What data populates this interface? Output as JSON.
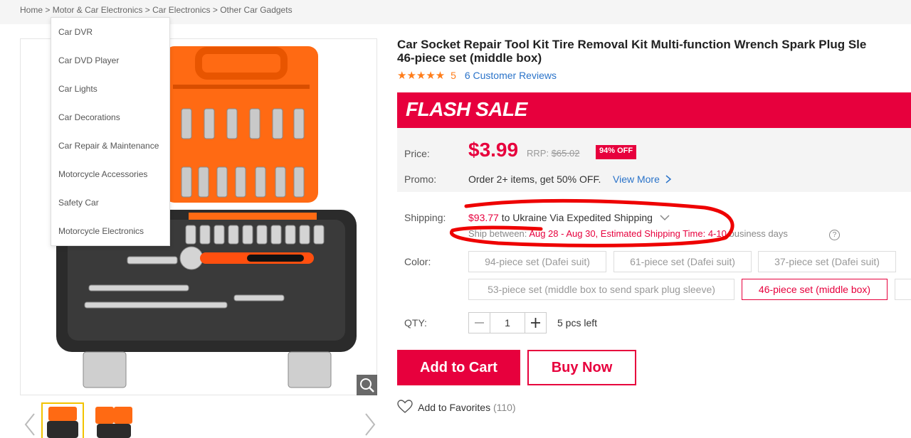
{
  "breadcrumb": {
    "items": [
      "Home",
      "Motor & Car Electronics",
      "Car Electronics",
      "Other Car Gadgets"
    ],
    "separator": ">"
  },
  "category_menu": {
    "items": [
      "Car DVR",
      "Car DVD Player",
      "Car Lights",
      "Car Decorations",
      "Car Repair & Maintenance",
      "Motorcycle Accessories",
      "Safety Car",
      "Motorcycle Electronics"
    ]
  },
  "product": {
    "title_line1": "Car Socket Repair Tool Kit Tire Removal Kit Multi-function Wrench Spark Plug Sle",
    "title_line2": "46-piece set (middle box)",
    "stars": "★★★★★",
    "rating": "5",
    "reviews": "6 Customer Reviews",
    "image_hint": "orange-black-socket-tool-case"
  },
  "flash_sale": {
    "label": "FLASH SALE"
  },
  "pricing": {
    "price_label": "Price:",
    "price": "$3.99",
    "rrp_label": "RRP:",
    "rrp_value": "$65.02",
    "discount": "94% OFF",
    "promo_label": "Promo:",
    "promo_text": "Order 2+ items, get 50% OFF.",
    "view_more": "View More"
  },
  "shipping": {
    "label": "Shipping:",
    "cost": "$93.77",
    "destination": "to Ukraine Via Expedited Shipping",
    "ship_between_label": "Ship between:",
    "ship_dates": "Aug 28 - Aug 30,",
    "estimated_label": "Estimated Shipping Time:",
    "estimated_days": "4-10",
    "business_days": "business days",
    "help": "?"
  },
  "color": {
    "label": "Color:",
    "options": [
      "94-piece set (Dafei suit)",
      "61-piece set (Dafei suit)",
      "37-piece set (Dafei suit)",
      "53-piece set (middle box to send spark plug sleeve)",
      "46-piece set (middle box)"
    ],
    "selected": "46-piece set (middle box)"
  },
  "quantity": {
    "label": "QTY:",
    "value": "1",
    "stock": "5 pcs left"
  },
  "actions": {
    "add_to_cart": "Add to Cart",
    "buy_now": "Buy Now",
    "favorites": "Add to Favorites",
    "favorites_count": "(110)"
  },
  "colors": {
    "accent": "#e7003d",
    "link": "#2a73c9",
    "star": "#ff7d1a",
    "case_orange": "#ff6a13"
  }
}
